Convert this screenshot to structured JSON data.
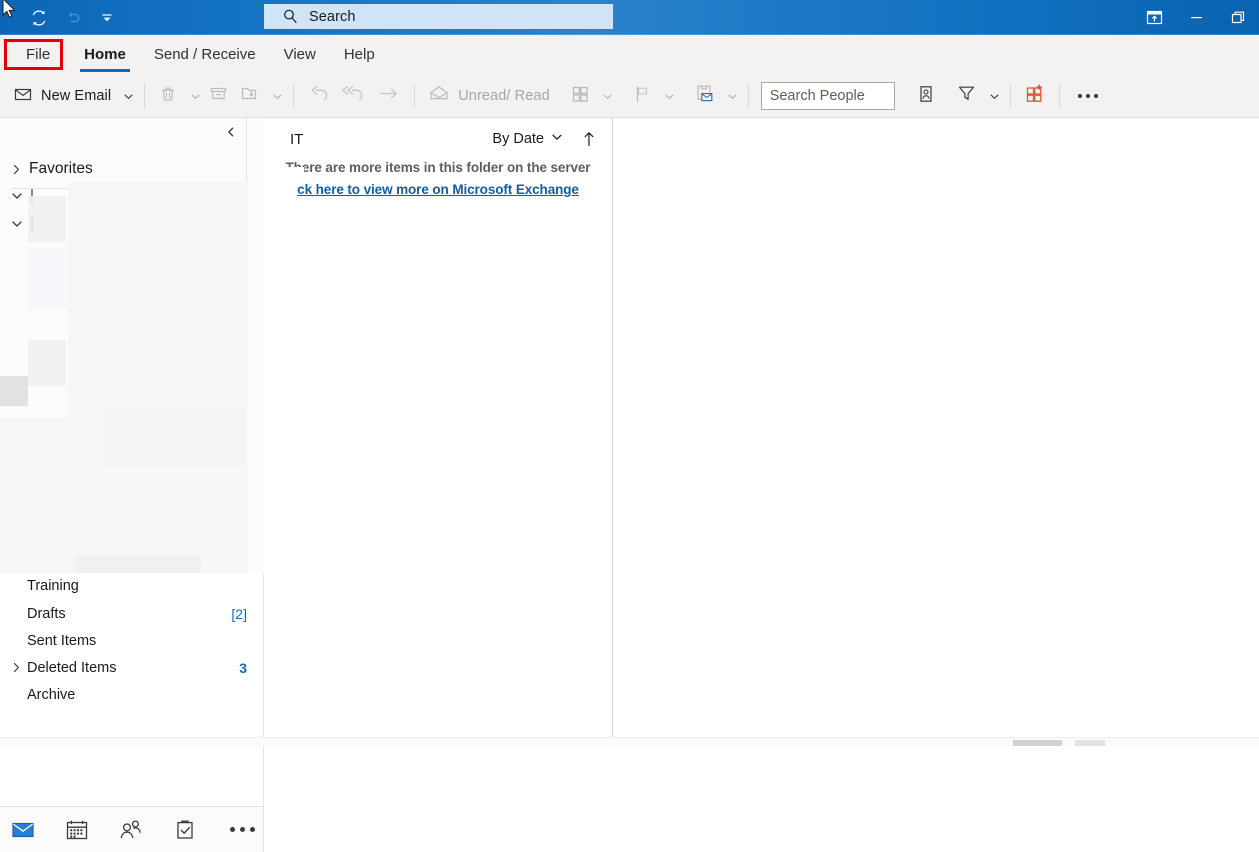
{
  "titlebar": {
    "quick_access": [
      {
        "name": "sync-icon",
        "tooltip": "Send/Receive All Folders"
      },
      {
        "name": "undo-icon",
        "tooltip": "Undo"
      },
      {
        "name": "customize-quick-access-icon",
        "tooltip": "Customize Quick Access Toolbar"
      }
    ],
    "search": {
      "placeholder": "Search",
      "icon": "search-icon"
    },
    "window_controls": [
      {
        "name": "ribbon-display-options-icon",
        "label": "Ribbon Display Options"
      },
      {
        "name": "minimize-icon",
        "label": "Minimize"
      },
      {
        "name": "restore-icon",
        "label": "Restore Down"
      }
    ],
    "accent_color": "#0f6cbd"
  },
  "ribbon": {
    "tabs": [
      {
        "label": "File",
        "active": false,
        "highlighted": true
      },
      {
        "label": "Home",
        "active": true,
        "highlighted": false
      },
      {
        "label": "Send / Receive",
        "active": false,
        "highlighted": false
      },
      {
        "label": "View",
        "active": false,
        "highlighted": false
      },
      {
        "label": "Help",
        "active": false,
        "highlighted": false
      }
    ],
    "highlight_color": "#e60000"
  },
  "toolbar": {
    "new_email": {
      "label": "New Email",
      "icon": "envelope-icon"
    },
    "delete": {
      "icon": "trash-icon"
    },
    "archive": {
      "icon": "archive-box-icon"
    },
    "move": {
      "icon": "move-to-folder-icon"
    },
    "reply": {
      "icon": "reply-arrow-icon"
    },
    "reply_all": {
      "icon": "reply-all-arrow-icon"
    },
    "forward": {
      "icon": "forward-arrow-icon"
    },
    "unread_read": {
      "label": "Unread/ Read",
      "icon": "open-envelope-icon"
    },
    "categorize": {
      "icon": "categorize-grid-icon"
    },
    "follow_up": {
      "icon": "flag-icon"
    },
    "quick_steps": {
      "icon": "quick-steps-icon"
    },
    "search_people": {
      "placeholder": "Search People",
      "value": ""
    },
    "address_book": {
      "icon": "address-book-icon"
    },
    "filter_email": {
      "icon": "funnel-icon"
    },
    "get_addins": {
      "icon": "get-addins-icon",
      "color": "#d9553a"
    },
    "overflow": {
      "icon": "ellipsis-icon"
    }
  },
  "sidebar": {
    "collapse": {
      "icon": "chevron-left-icon"
    },
    "favorites": {
      "label": "Favorites",
      "icon": "chevron-right-icon",
      "expanded": false
    },
    "folders": [
      {
        "label": "Training",
        "count": "",
        "chevron": false,
        "clipped": true
      },
      {
        "label": "Drafts",
        "count": "[2]",
        "chevron": false,
        "bold_count": false
      },
      {
        "label": "Sent Items",
        "count": "",
        "chevron": false
      },
      {
        "label": "Deleted Items",
        "count": "3",
        "chevron": true,
        "bold_count": true
      },
      {
        "label": "Archive",
        "count": "",
        "chevron": false,
        "clipped": true
      }
    ],
    "bottom_nav": [
      {
        "name": "mail-icon",
        "label": "Mail",
        "active": true
      },
      {
        "name": "calendar-icon",
        "label": "Calendar",
        "active": false
      },
      {
        "name": "people-icon",
        "label": "People",
        "active": false
      },
      {
        "name": "tasks-icon",
        "label": "Tasks",
        "active": false
      },
      {
        "name": "more-apps-icon",
        "label": "More",
        "active": false
      }
    ]
  },
  "message_list": {
    "folder_title": "IT",
    "sort": {
      "label": "By Date",
      "icon": "chevron-down-icon"
    },
    "sort_direction": {
      "icon": "arrow-up-icon"
    },
    "server_note": "There are more items in this folder on the server",
    "server_link": "ck here to view more on Microsoft Exchange",
    "items": []
  },
  "reading_pane": {
    "content": ""
  }
}
